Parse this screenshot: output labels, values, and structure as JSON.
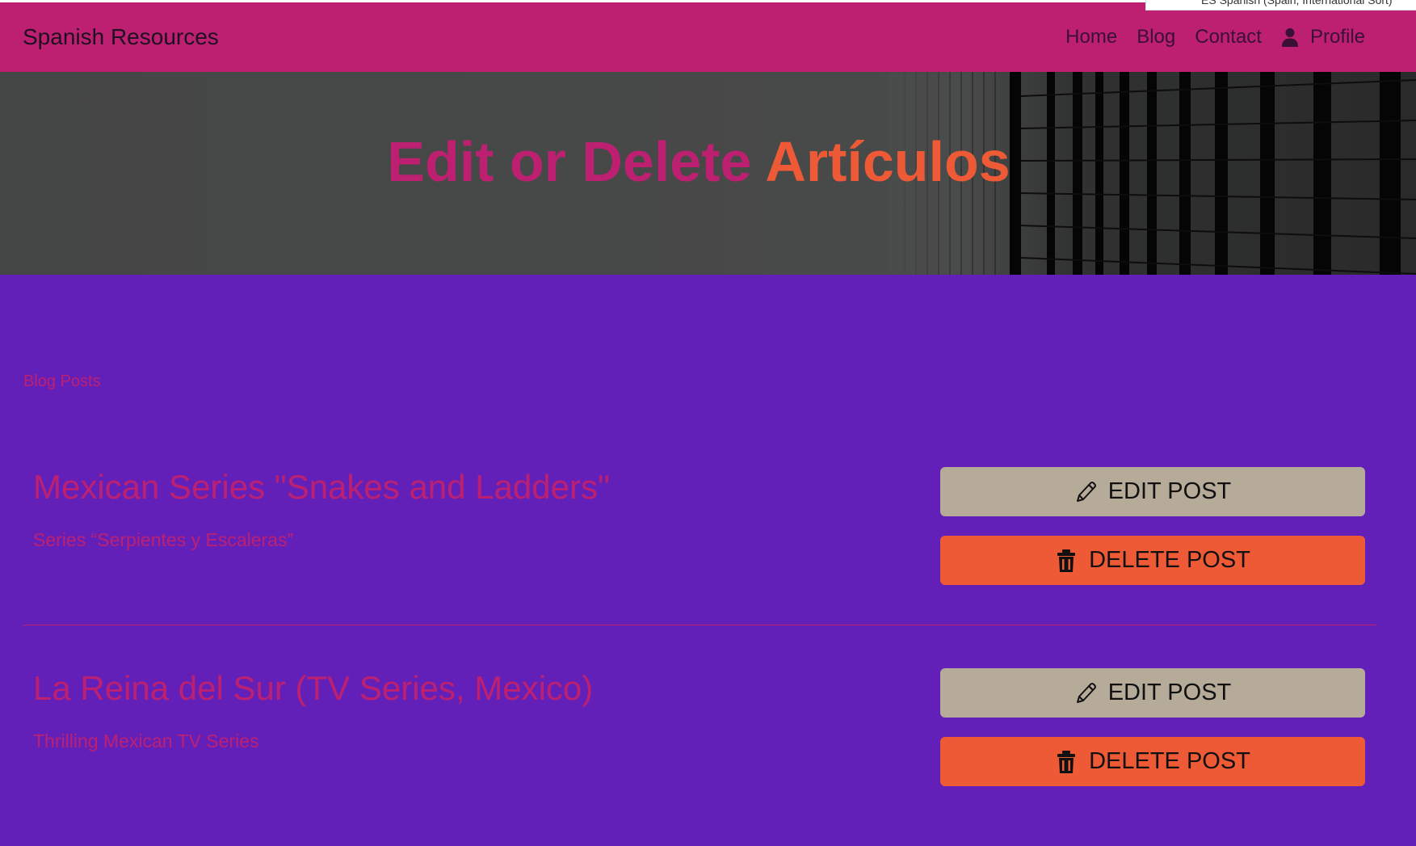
{
  "popup": {
    "text": "ES Spanish (Spain, International Sort)"
  },
  "navbar": {
    "brand": "Spanish Resources",
    "links": [
      {
        "label": "Home"
      },
      {
        "label": "Blog"
      },
      {
        "label": "Contact"
      },
      {
        "label": "Profile",
        "icon": "user-icon"
      }
    ]
  },
  "hero": {
    "title_part1": "Edit or Delete ",
    "title_part2": "Artículos"
  },
  "section": {
    "label": "Blog Posts"
  },
  "posts": [
    {
      "title": "Mexican Series \"Snakes and Ladders\"",
      "subtitle": "Series “Serpientes y Escaleras”",
      "edit_label": "EDIT POST",
      "delete_label": "DELETE POST"
    },
    {
      "title": "La Reina del Sur (TV Series, Mexico)",
      "subtitle": "Thrilling Mexican TV Series",
      "edit_label": "EDIT POST",
      "delete_label": "DELETE POST"
    }
  ],
  "icons": {
    "edit": "pencil-icon",
    "delete": "trash-icon",
    "profile": "user-icon"
  },
  "colors": {
    "navbar": "#bd2071",
    "page_background": "#6320b8",
    "accent_pink": "#bd2071",
    "accent_orange": "#ee5a36",
    "edit_button": "#b6ab99",
    "delete_button": "#ee5a36"
  }
}
